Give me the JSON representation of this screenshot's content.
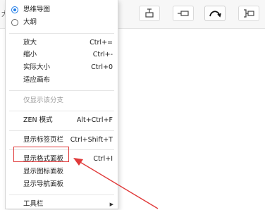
{
  "toolbar": {
    "fragment_text": "大"
  },
  "menu": {
    "view_mode": {
      "mindmap_label": "思维导图",
      "mindmap_selected": true,
      "outline_label": "大纲",
      "outline_selected": false
    },
    "zoom_in_label": "放大",
    "zoom_in_shortcut": "Ctrl+=",
    "zoom_out_label": "缩小",
    "zoom_out_shortcut": "Ctrl+-",
    "actual_size_label": "实际大小",
    "actual_size_shortcut": "Ctrl+0",
    "fit_canvas_label": "适应画布",
    "only_branch_label": "仅显示该分支",
    "zen_label": "ZEN 模式",
    "zen_shortcut": "Alt+Ctrl+F",
    "show_tabbar_label": "显示标签页栏",
    "show_tabbar_shortcut": "Ctrl+Shift+T",
    "show_format_panel_label": "显示格式面板",
    "show_format_panel_shortcut": "Ctrl+I",
    "show_icon_panel_label": "显示图标面板",
    "show_nav_panel_label": "显示导航面板",
    "toolbar_label": "工具栏"
  },
  "colors": {
    "accent": "#1f7ce8",
    "annotation": "#e03a3a"
  }
}
